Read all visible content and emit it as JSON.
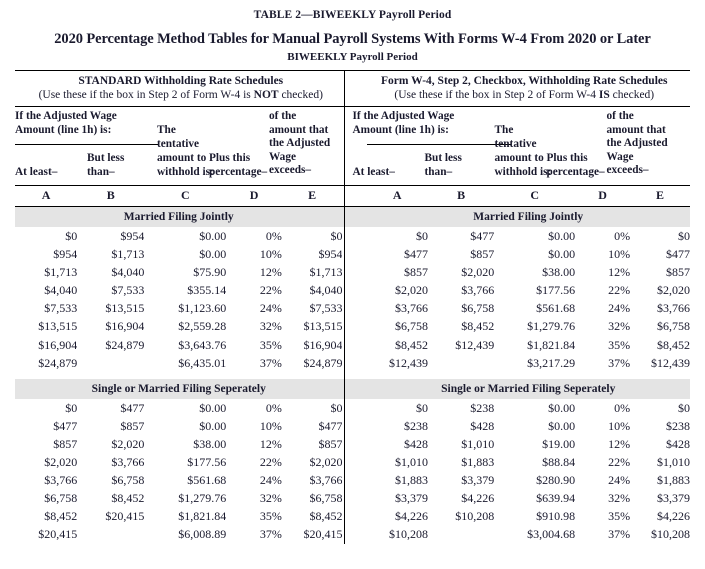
{
  "document": {
    "table_label": "TABLE 2—BIWEEKLY Payroll Period",
    "main_title": "2020 Percentage Method Tables for Manual Payroll Systems With Forms W-4 From 2020 or Later",
    "period_subtitle": "BIWEEKLY Payroll Period"
  },
  "schedules": {
    "left": {
      "title": "STANDARD Withholding Rate Schedules",
      "note_prefix": "(Use these if the box in Step 2 of Form W-4 is ",
      "note_emphasis": "NOT",
      "note_suffix": " checked)"
    },
    "right": {
      "title": "Form W-4, Step 2, Checkbox, Withholding Rate Schedules",
      "note_prefix": "(Use these if the box in Step 2 of Form W-4 ",
      "note_emphasis": "IS",
      "note_suffix": " checked)"
    }
  },
  "column_headers": {
    "adjusted_wage_line1": "If the Adjusted Wage",
    "adjusted_wage_line2": "Amount (line 1h) is:",
    "the": "The",
    "tentative": "tentative",
    "amount_to": "amount to",
    "withhold_is": "withhold is:",
    "plus_this": "Plus this",
    "percentage": "percentage–",
    "of_the": "of the",
    "amount_that": "amount that",
    "the_adjusted": "the Adjusted",
    "wage": "Wage",
    "exceeds": "exceeds–",
    "at_least": "At least–",
    "but_less": "But less",
    "than": "than–"
  },
  "column_letters": [
    "A",
    "B",
    "C",
    "D",
    "E"
  ],
  "sections": [
    {
      "band_label": "Married Filing Jointly",
      "left_rows": [
        [
          "$0",
          "$954",
          "$0.00",
          "0%",
          "$0"
        ],
        [
          "$954",
          "$1,713",
          "$0.00",
          "10%",
          "$954"
        ],
        [
          "$1,713",
          "$4,040",
          "$75.90",
          "12%",
          "$1,713"
        ],
        [
          "$4,040",
          "$7,533",
          "$355.14",
          "22%",
          "$4,040"
        ],
        [
          "$7,533",
          "$13,515",
          "$1,123.60",
          "24%",
          "$7,533"
        ],
        [
          "$13,515",
          "$16,904",
          "$2,559.28",
          "32%",
          "$13,515"
        ],
        [
          "$16,904",
          "$24,879",
          "$3,643.76",
          "35%",
          "$16,904"
        ],
        [
          "$24,879",
          "",
          "$6,435.01",
          "37%",
          "$24,879"
        ]
      ],
      "right_rows": [
        [
          "$0",
          "$477",
          "$0.00",
          "0%",
          "$0"
        ],
        [
          "$477",
          "$857",
          "$0.00",
          "10%",
          "$477"
        ],
        [
          "$857",
          "$2,020",
          "$38.00",
          "12%",
          "$857"
        ],
        [
          "$2,020",
          "$3,766",
          "$177.56",
          "22%",
          "$2,020"
        ],
        [
          "$3,766",
          "$6,758",
          "$561.68",
          "24%",
          "$3,766"
        ],
        [
          "$6,758",
          "$8,452",
          "$1,279.76",
          "32%",
          "$6,758"
        ],
        [
          "$8,452",
          "$12,439",
          "$1,821.84",
          "35%",
          "$8,452"
        ],
        [
          "$12,439",
          "",
          "$3,217.29",
          "37%",
          "$12,439"
        ]
      ]
    },
    {
      "band_label": "Single or Married Filing Seperately",
      "left_rows": [
        [
          "$0",
          "$477",
          "$0.00",
          "0%",
          "$0"
        ],
        [
          "$477",
          "$857",
          "$0.00",
          "10%",
          "$477"
        ],
        [
          "$857",
          "$2,020",
          "$38.00",
          "12%",
          "$857"
        ],
        [
          "$2,020",
          "$3,766",
          "$177.56",
          "22%",
          "$2,020"
        ],
        [
          "$3,766",
          "$6,758",
          "$561.68",
          "24%",
          "$3,766"
        ],
        [
          "$6,758",
          "$8,452",
          "$1,279.76",
          "32%",
          "$6,758"
        ],
        [
          "$8,452",
          "$20,415",
          "$1,821.84",
          "35%",
          "$8,452"
        ],
        [
          "$20,415",
          "",
          "$6,008.89",
          "37%",
          "$20,415"
        ]
      ],
      "right_rows": [
        [
          "$0",
          "$238",
          "$0.00",
          "0%",
          "$0"
        ],
        [
          "$238",
          "$428",
          "$0.00",
          "10%",
          "$238"
        ],
        [
          "$428",
          "$1,010",
          "$19.00",
          "12%",
          "$428"
        ],
        [
          "$1,010",
          "$1,883",
          "$88.84",
          "22%",
          "$1,010"
        ],
        [
          "$1,883",
          "$3,379",
          "$280.90",
          "24%",
          "$1,883"
        ],
        [
          "$3,379",
          "$4,226",
          "$639.94",
          "32%",
          "$3,379"
        ],
        [
          "$4,226",
          "$10,208",
          "$910.98",
          "35%",
          "$4,226"
        ],
        [
          "$10,208",
          "",
          "$3,004.68",
          "37%",
          "$10,208"
        ]
      ]
    }
  ],
  "colors": {
    "band_background": "#e4e4e4",
    "rule": "#000000",
    "text": "#1a1a2e"
  }
}
